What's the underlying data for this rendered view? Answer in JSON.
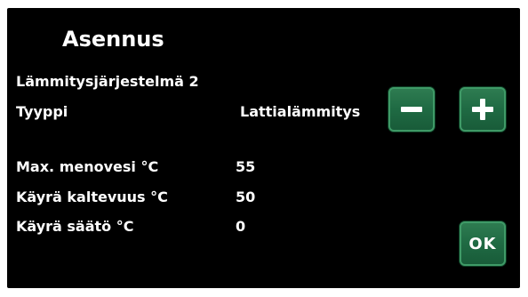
{
  "header": {
    "title": "Asennus"
  },
  "system": {
    "name": "Lämmitysjärjestelmä 2"
  },
  "type_row": {
    "label": "Tyyppi",
    "value": "Lattialämmitys"
  },
  "settings": [
    {
      "label": "Max. menovesi °C",
      "value": "55"
    },
    {
      "label": "Käyrä kaltevuus °C",
      "value": "50"
    },
    {
      "label": "Käyrä säätö °C",
      "value": "0"
    }
  ],
  "buttons": {
    "minus_icon": "minus-icon",
    "plus_icon": "plus-icon",
    "ok_label": "OK"
  },
  "colors": {
    "background": "#000000",
    "text": "#ffffff",
    "button_green": "#1f6a43"
  }
}
